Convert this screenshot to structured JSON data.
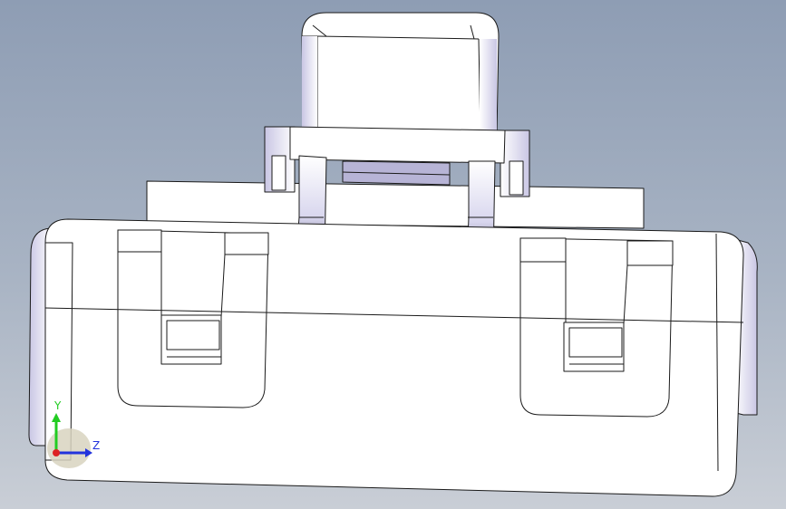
{
  "viewport": {
    "background_top": "#8e9db4",
    "background_bottom": "#c9ced6",
    "part_fill": "#ffffff",
    "part_edge": "#1a1a1a",
    "shade_color": "#b7b4d6",
    "deep_shade_color": "#6e6b86"
  },
  "triad": {
    "y_label": "Y",
    "z_label": "Z",
    "y_color": "#22cc22",
    "z_color": "#2233dd",
    "x_color": "#dd2222"
  }
}
